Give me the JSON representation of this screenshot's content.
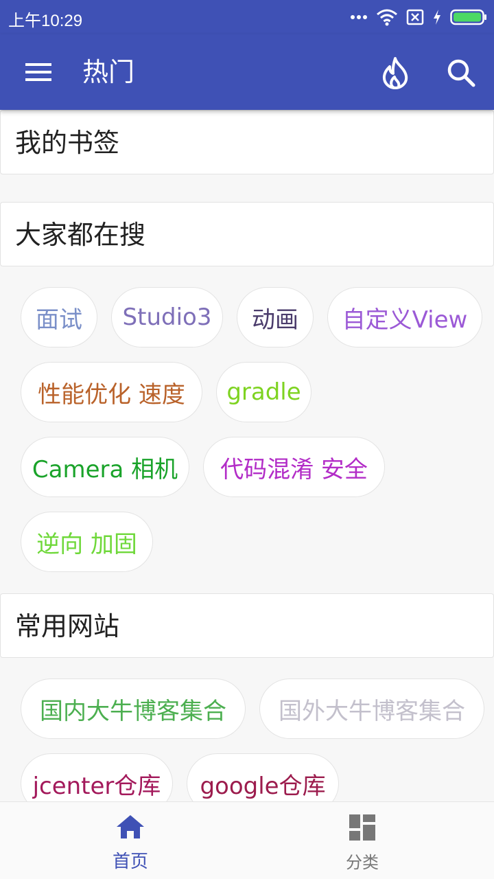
{
  "status_bar": {
    "time": "上午10:29"
  },
  "toolbar": {
    "title": "热门",
    "menu_icon": "hamburger-menu-icon",
    "hot_icon": "flame-icon",
    "search_icon": "search-icon",
    "color": "#3f51b5"
  },
  "sections": {
    "bookmarks": {
      "title": "我的书签"
    },
    "hot_searches": {
      "title": "大家都在搜",
      "tags": [
        {
          "label": "面试",
          "color": "#7a8fc8"
        },
        {
          "label": "Studio3",
          "color": "#7e6fb8"
        },
        {
          "label": "动画",
          "color": "#4a3b6b"
        },
        {
          "label": "自定义View",
          "color": "#9b59d6"
        },
        {
          "label": "性能优化 速度",
          "color": "#b9622a"
        },
        {
          "label": "gradle",
          "color": "#7ed321"
        },
        {
          "label": "Camera 相机",
          "color": "#1aa32a"
        },
        {
          "label": "代码混淆 安全",
          "color": "#b22cc7"
        },
        {
          "label": "逆向 加固",
          "color": "#6fd83a"
        }
      ]
    },
    "websites": {
      "title": "常用网站",
      "tags": [
        {
          "label": "国内大牛博客集合",
          "color": "#4caf50"
        },
        {
          "label": "国外大牛博客集合",
          "color": "#c3c0cc"
        },
        {
          "label": "jcenter仓库",
          "color": "#a3195b"
        },
        {
          "label": "google仓库",
          "color": "#9c1c4d"
        }
      ]
    }
  },
  "bottom_nav": {
    "items": [
      {
        "label": "首页",
        "icon": "home-icon",
        "active": true
      },
      {
        "label": "分类",
        "icon": "dashboard-grid-icon",
        "active": false
      }
    ]
  }
}
